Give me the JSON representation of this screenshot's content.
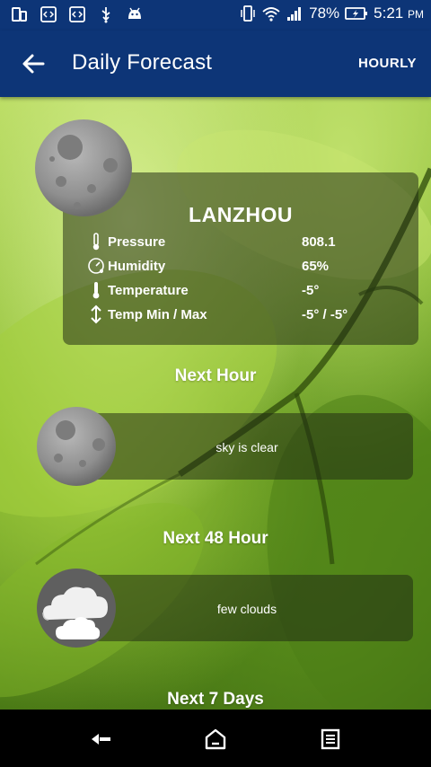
{
  "status_bar": {
    "battery": "78%",
    "time": "5:21",
    "ampm": "PM"
  },
  "app_bar": {
    "title": "Daily Forecast",
    "action": "HOURLY"
  },
  "city": {
    "name": "LANZHOU",
    "stats": [
      {
        "label": "Pressure",
        "value": "808.1",
        "icon": "thermometer-icon"
      },
      {
        "label": "Humidity",
        "value": "65%",
        "icon": "gauge-icon"
      },
      {
        "label": "Temperature",
        "value": "-5°",
        "icon": "thermometer-icon"
      },
      {
        "label": "Temp Min / Max",
        "value": "-5° / -5°",
        "icon": "vertical-arrows-icon"
      }
    ]
  },
  "sections": {
    "next_hour": "Next Hour",
    "next_48": "Next 48 Hour",
    "next_7": "Next 7 Days"
  },
  "forecasts": {
    "next_hour": {
      "description": "sky is clear",
      "icon": "moon-icon"
    },
    "next_48": {
      "description": "few clouds",
      "icon": "clouds-icon"
    }
  }
}
